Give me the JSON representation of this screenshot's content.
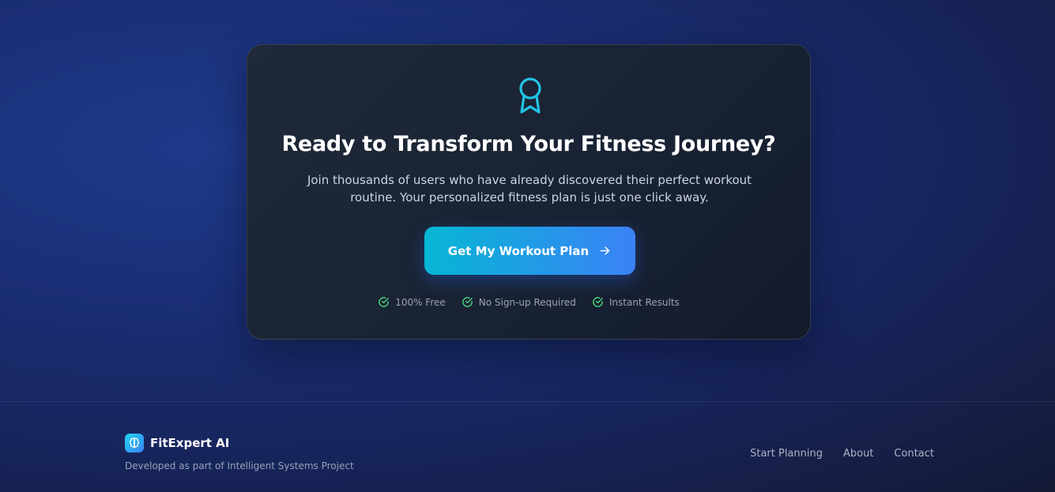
{
  "cta": {
    "title": "Ready to Transform Your Fitness Journey?",
    "description": "Join thousands of users who have already discovered their perfect workout routine. Your personalized fitness plan is just one click away.",
    "button_label": "Get My Workout Plan",
    "icon": "award-icon",
    "features": [
      {
        "label": "100% Free",
        "icon": "check-circle-icon"
      },
      {
        "label": "No Sign-up Required",
        "icon": "check-circle-icon"
      },
      {
        "label": "Instant Results",
        "icon": "check-circle-icon"
      }
    ]
  },
  "footer": {
    "brand_name": "FitExpert AI",
    "brand_icon": "brain-icon",
    "tagline": "Developed as part of Intelligent Systems Project",
    "nav": [
      {
        "label": "Start Planning"
      },
      {
        "label": "About"
      },
      {
        "label": "Contact"
      }
    ]
  },
  "colors": {
    "accent_cyan": "#06b6d4",
    "accent_blue": "#3b82f6",
    "check_green": "#4ade80",
    "card_bg": "#1f2937",
    "page_bg": "#1b2f78"
  }
}
